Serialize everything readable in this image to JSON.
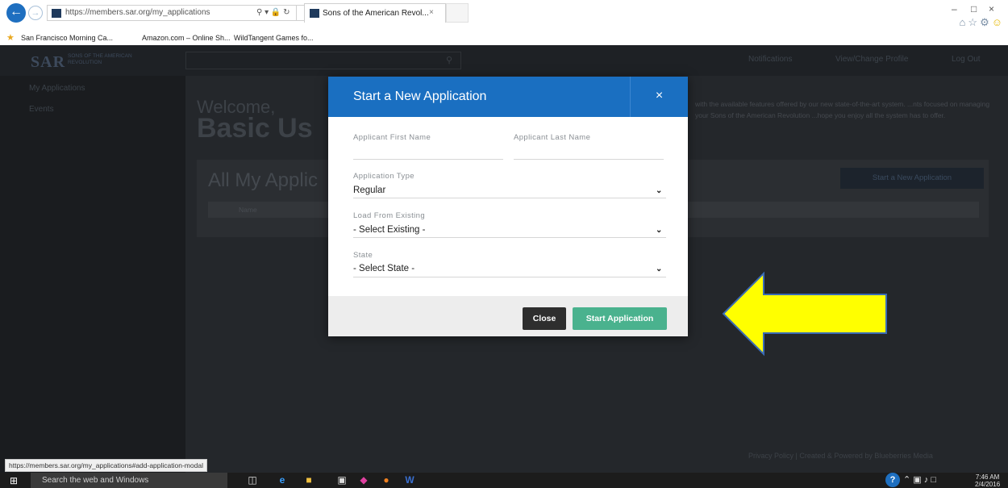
{
  "browser": {
    "url": "https://members.sar.org/my_applications",
    "tab_title": "Sons of the American Revol...",
    "favorites": [
      "San Francisco Morning Ca...",
      "Amazon.com – Online Sh...",
      "WildTangent Games fo..."
    ]
  },
  "site": {
    "logo": "SAR",
    "logo_sub": "SONS OF THE AMERICAN REVOLUTION",
    "nav": {
      "notifications": "Notifications",
      "profile": "View/Change Profile",
      "logout": "Log Out"
    },
    "sidebar": [
      "My Applications",
      "Events"
    ],
    "welcome": "Welcome,",
    "username": "Basic Us",
    "blurb": "with the available features offered by our new state-of-the-art system. ...nts focused on managing your Sons of the American Revolution ...hope you enjoy all the system has to offer.",
    "card_title": "All My Applic",
    "card_button": "Start a New Application",
    "card_columns": "Name",
    "footer": "Privacy Policy | Created & Powered by Blueberries Media"
  },
  "modal": {
    "title": "Start a New Application",
    "first_name_label": "Applicant First Name",
    "last_name_label": "Applicant Last Name",
    "type_label": "Application Type",
    "type_value": "Regular",
    "existing_label": "Load From Existing",
    "existing_value": "- Select Existing -",
    "state_label": "State",
    "state_value": "- Select State -",
    "close_label": "Close",
    "start_label": "Start Application"
  },
  "status_url": "https://members.sar.org/my_applications#add-application-modal",
  "taskbar": {
    "search_placeholder": "Search the web and Windows",
    "time": "7:46 AM",
    "date": "2/4/2016"
  },
  "colors": {
    "modal_header": "#1a6fc1",
    "start_button": "#4ab28e",
    "arrow": "#ffff00"
  }
}
